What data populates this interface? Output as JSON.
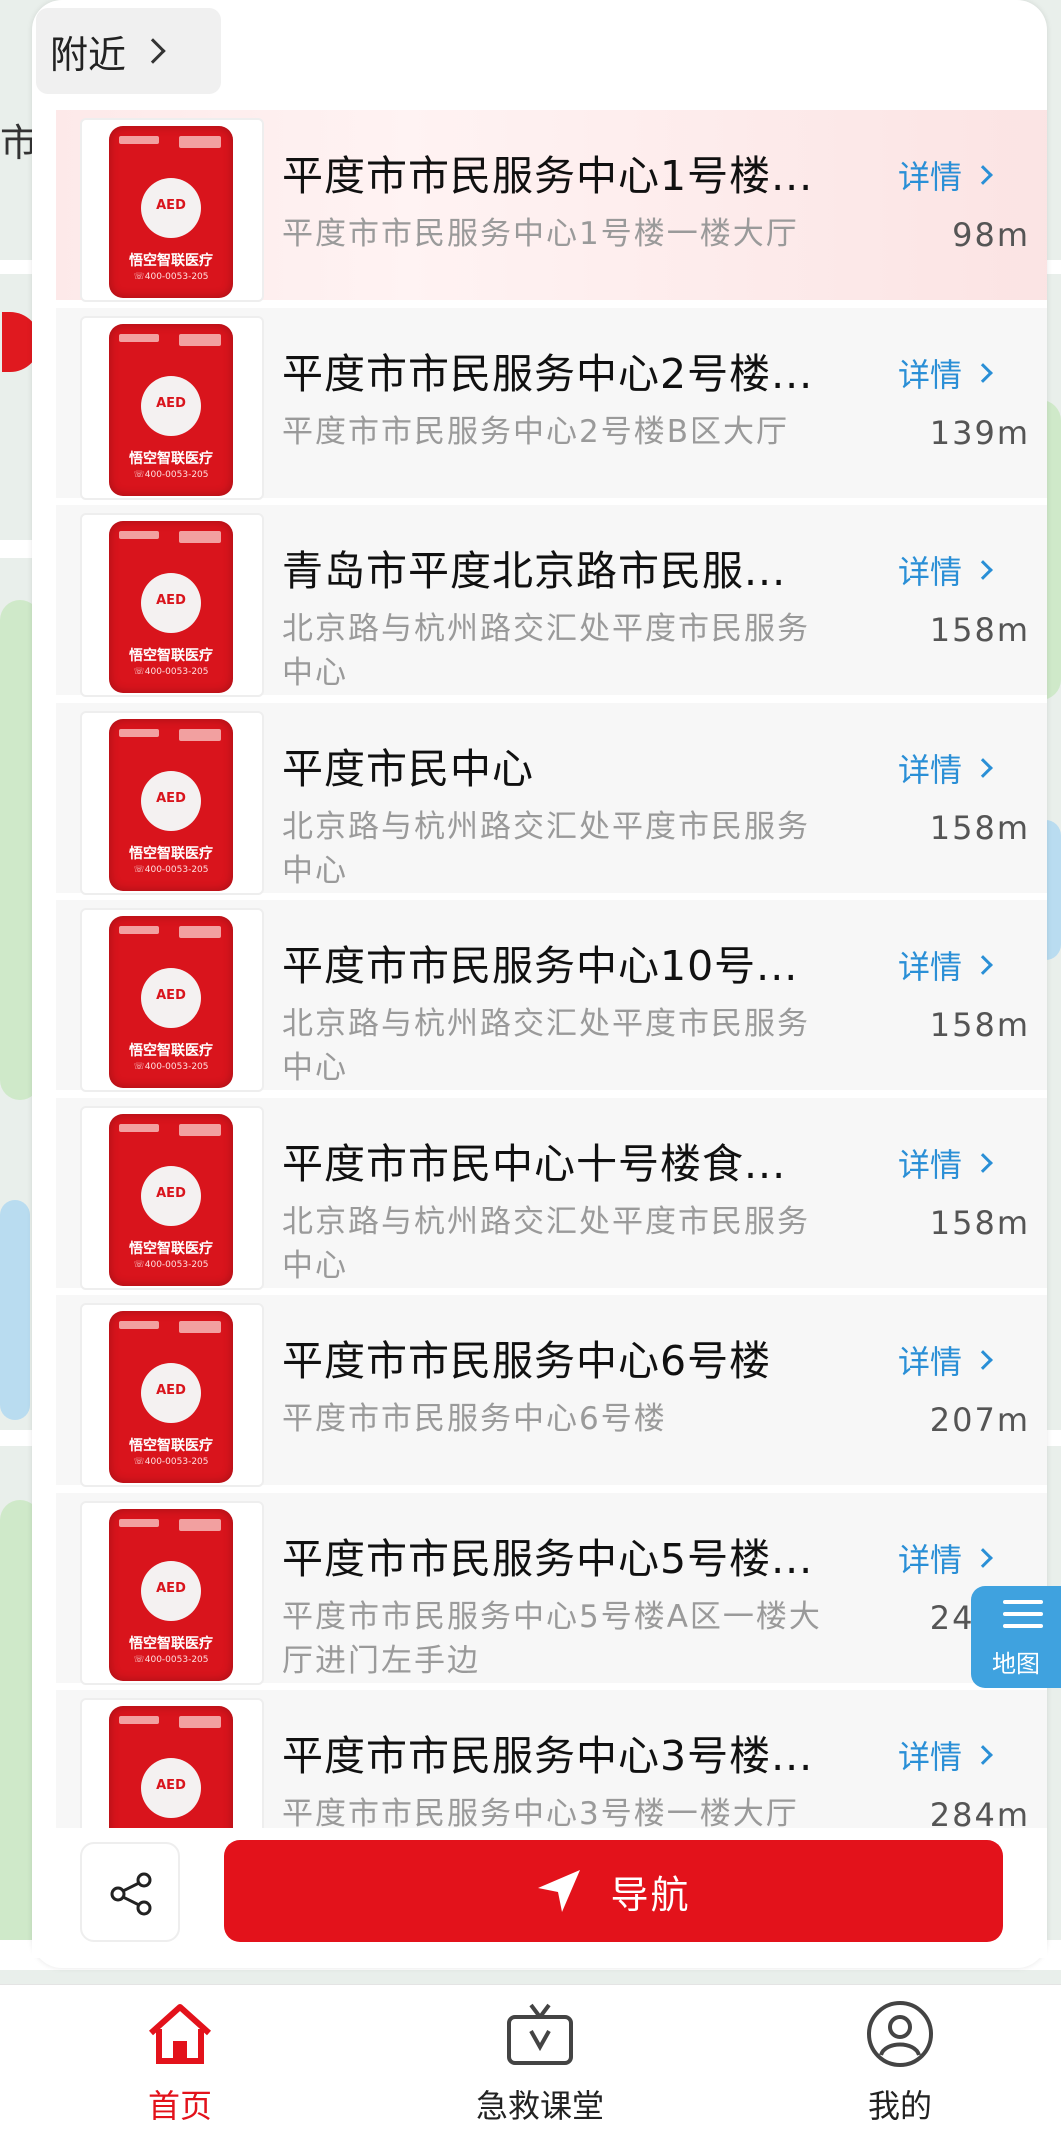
{
  "map": {
    "city_label": "市",
    "toggle_label": "地图"
  },
  "header": {
    "nearby_label": "附近"
  },
  "items": [
    {
      "title": "平度市市民服务中心1号楼...",
      "address": "平度市市民服务中心1号楼一楼大厅",
      "distance": "98m",
      "detail_label": "详情",
      "active": true
    },
    {
      "title": "平度市市民服务中心2号楼...",
      "address": "平度市市民服务中心2号楼B区大厅",
      "distance": "139m",
      "detail_label": "详情"
    },
    {
      "title": "青岛市平度北京路市民服...",
      "address": "北京路与杭州路交汇处平度市民服务中心",
      "distance": "158m",
      "detail_label": "详情"
    },
    {
      "title": "平度市民中心",
      "address": "北京路与杭州路交汇处平度市民服务中心",
      "distance": "158m",
      "detail_label": "详情"
    },
    {
      "title": "平度市市民服务中心10号...",
      "address": "北京路与杭州路交汇处平度市民服务中心",
      "distance": "158m",
      "detail_label": "详情"
    },
    {
      "title": "平度市市民中心十号楼食...",
      "address": "北京路与杭州路交汇处平度市民服务中心",
      "distance": "158m",
      "detail_label": "详情"
    },
    {
      "title": "平度市市民服务中心6号楼",
      "address": "平度市市民服务中心6号楼",
      "distance": "207m",
      "detail_label": "详情"
    },
    {
      "title": "平度市市民服务中心5号楼...",
      "address": "平度市市民服务中心5号楼A区一楼大厅进门左手边",
      "distance": "249m",
      "detail_label": "详情"
    },
    {
      "title": "平度市市民服务中心3号楼...",
      "address": "平度市市民服务中心3号楼一楼大厅",
      "distance": "284m",
      "detail_label": "详情"
    }
  ],
  "aed_card": {
    "badge": "AED",
    "brand": "悟空智联医疗",
    "phone": "☏400-0053-205"
  },
  "actions": {
    "share_icon": "share-icon",
    "nav_label": "导航"
  },
  "bottom_nav": [
    {
      "label": "首页",
      "icon": "home-icon",
      "active": true
    },
    {
      "label": "急救课堂",
      "icon": "video-icon"
    },
    {
      "label": "我的",
      "icon": "user-icon"
    }
  ],
  "colors": {
    "brand_red": "#e3121b",
    "link_blue": "#2a8fd6",
    "map_button_blue": "#3fa2df"
  }
}
